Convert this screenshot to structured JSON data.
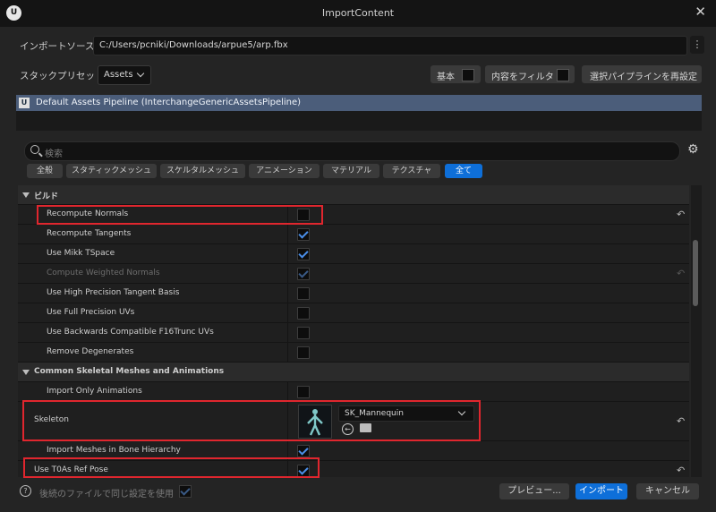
{
  "window": {
    "title": "ImportContent"
  },
  "source": {
    "label": "インポートソース",
    "path": "C:/Users/pcniki/Downloads/arpue5/arp.fbx"
  },
  "preset": {
    "label": "スタックプリセット",
    "value": "Assets"
  },
  "top_buttons": {
    "basic": "基本",
    "filter": "内容をフィルタ",
    "reset_pipeline": "選択パイプラインを再設定"
  },
  "pipeline": {
    "name": "Default Assets Pipeline (InterchangeGenericAssetsPipeline)"
  },
  "search": {
    "placeholder": "検索"
  },
  "tabs": [
    "全般",
    "スタティックメッシュ",
    "スケルタルメッシュ",
    "アニメーション",
    "マテリアル",
    "テクスチャ",
    "全て"
  ],
  "active_tab": "全て",
  "categories": {
    "build": "ビルド",
    "skeletal": "Common Skeletal Meshes and Animations"
  },
  "rows": {
    "recompute_normals": "Recompute Normals",
    "recompute_tangents": "Recompute Tangents",
    "use_mikk": "Use Mikk TSpace",
    "compute_weighted": "Compute Weighted Normals",
    "high_precision": "Use High Precision Tangent Basis",
    "full_precision_uvs": "Use Full Precision UVs",
    "backwards_compat": "Use Backwards Compatible F16Trunc UVs",
    "remove_degenerates": "Remove Degenerates",
    "import_only_anim": "Import Only Animations",
    "skeleton": "Skeleton",
    "import_meshes_bone": "Import Meshes in Bone Hierarchy",
    "use_t0": "Use T0As Ref Pose"
  },
  "skeleton_asset": "SK_Mannequin",
  "footer": {
    "same_settings": "後続のファイルで同じ設定を使用",
    "preview": "プレビュー...",
    "import": "インポート",
    "cancel": "キャンセル"
  },
  "colors": {
    "accent": "#0e6fd9",
    "highlight": "#e0262e",
    "pipeline_row": "#4b5d7a"
  }
}
